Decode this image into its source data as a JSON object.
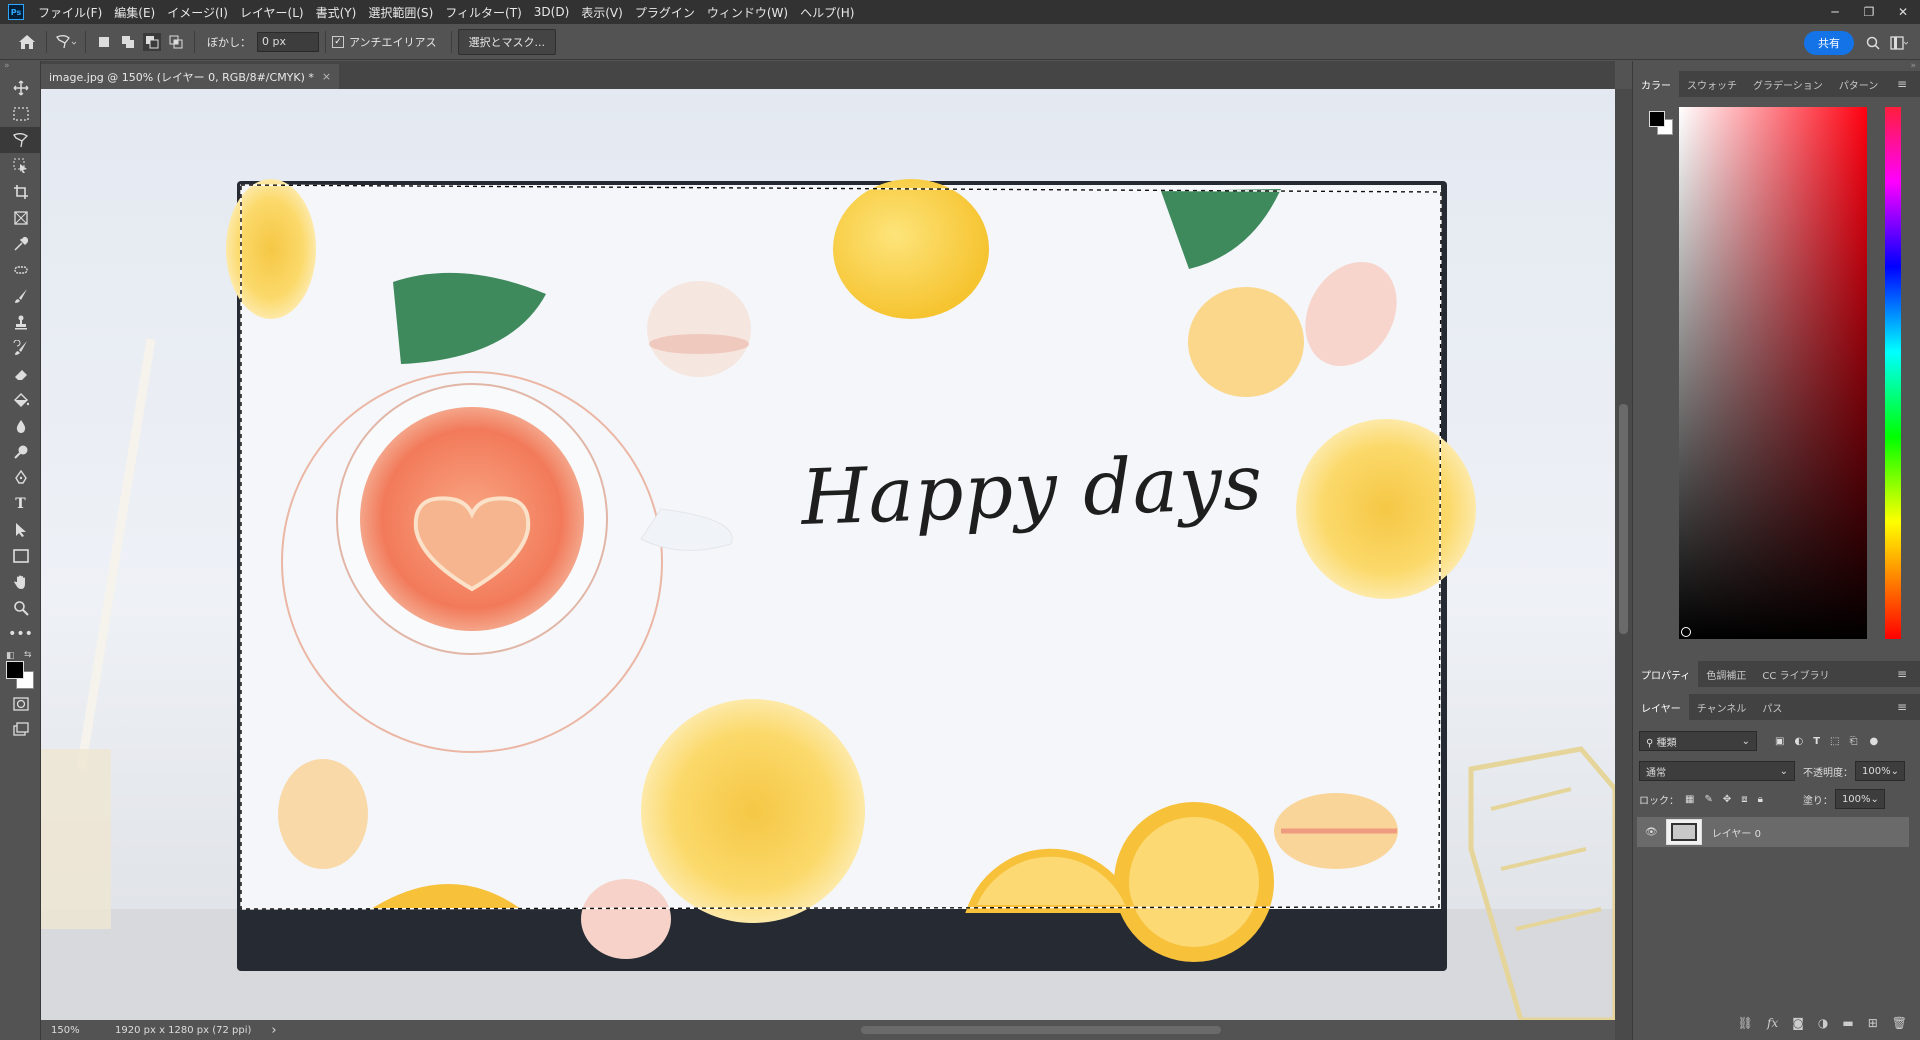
{
  "app": {
    "logo": "Ps"
  },
  "menu": [
    "ファイル(F)",
    "編集(E)",
    "イメージ(I)",
    "レイヤー(L)",
    "書式(Y)",
    "選択範囲(S)",
    "フィルター(T)",
    "3D(D)",
    "表示(V)",
    "プラグイン",
    "ウィンドウ(W)",
    "ヘルプ(H)"
  ],
  "window_controls": {
    "minimize": "─",
    "restore": "❐",
    "close": "✕"
  },
  "options": {
    "feather_label": "ぼかし：",
    "feather_value": "0 px",
    "antialias_label": "アンチエイリアス",
    "select_mask": "選択とマスク...",
    "share": "共有"
  },
  "document": {
    "tab_title": "image.jpg @ 150% (レイヤー 0, RGB/8#/CMYK) *",
    "close": "×",
    "canvas_text": "Happy days"
  },
  "status": {
    "zoom": "150%",
    "info": "1920 px x 1280 px (72 ppi)",
    "arrow": "›"
  },
  "panels": {
    "color_tabs": [
      "カラー",
      "スウォッチ",
      "グラデーション",
      "パターン"
    ],
    "props_tabs": [
      "プロパティ",
      "色調補正",
      "CC ライブラリ"
    ],
    "layer_tabs": [
      "レイヤー",
      "チャンネル",
      "パス"
    ],
    "filter_kind": "種類",
    "blend_mode": "通常",
    "opacity_label": "不透明度：",
    "opacity_value": "100%",
    "lock_label": "ロック：",
    "fill_label": "塗り：",
    "fill_value": "100%",
    "layer_name": "レイヤー 0"
  },
  "colors": {
    "accent": "#1473e6",
    "fg": "#000000",
    "bg": "#ffffff"
  }
}
